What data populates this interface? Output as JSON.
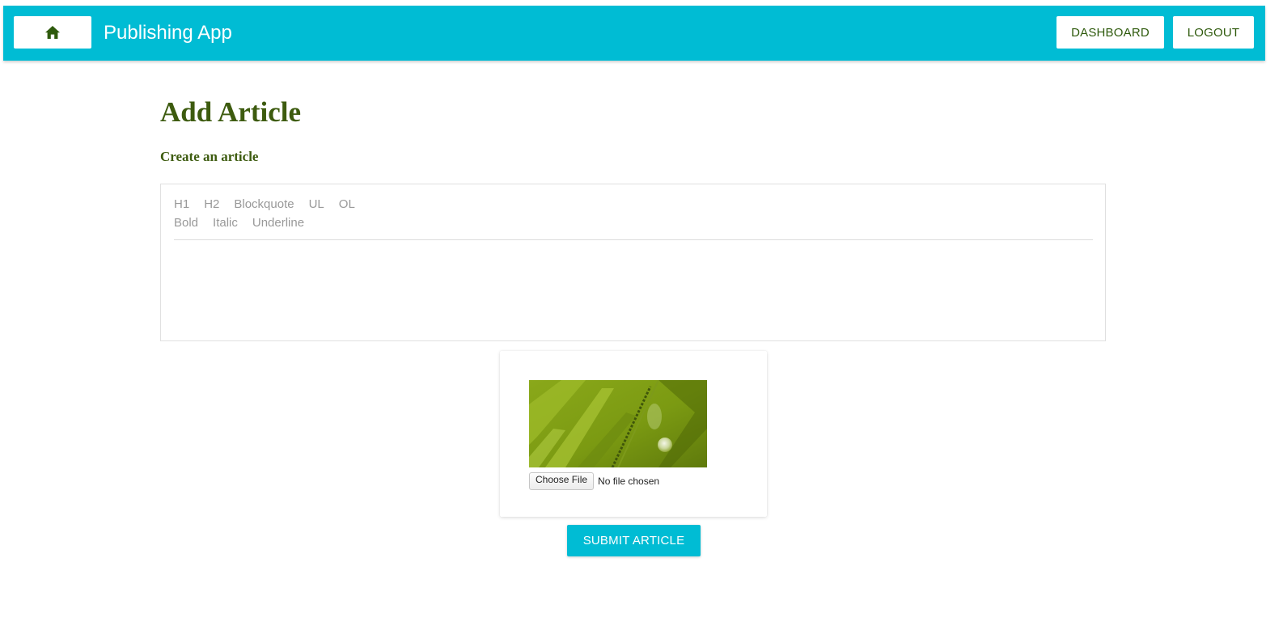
{
  "appbar": {
    "title": "Publishing App",
    "home_icon": "home-icon",
    "dashboard_label": "DASHBOARD",
    "logout_label": "LOGOUT",
    "background_color": "#00bcd4",
    "button_text_color": "#2e5a0c"
  },
  "page": {
    "title": "Add Article",
    "subtitle": "Create an article",
    "heading_color": "#3d5b0f"
  },
  "editor": {
    "toolbar_row1": [
      "H1",
      "H2",
      "Blockquote",
      "UL",
      "OL"
    ],
    "toolbar_row2": [
      "Bold",
      "Italic",
      "Underline"
    ],
    "content": ""
  },
  "image_upload": {
    "choose_file_label": "Choose File",
    "file_status": "No file chosen"
  },
  "submit": {
    "label": "SUBMIT ARTICLE"
  }
}
